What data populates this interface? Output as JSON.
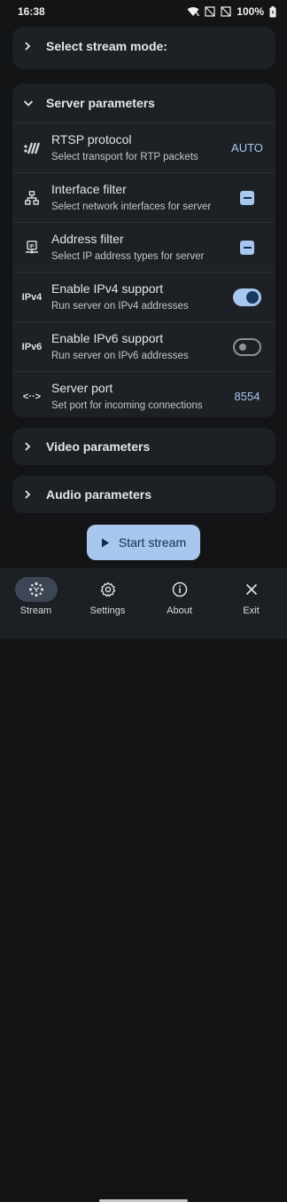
{
  "status_bar": {
    "time": "16:38",
    "battery": "100%"
  },
  "stream_mode": {
    "label": "Select stream mode:"
  },
  "server": {
    "label": "Server parameters",
    "rtsp": {
      "icon_text": ":///",
      "title": "RTSP protocol",
      "subtitle": "Select transport for RTP packets",
      "value": "AUTO"
    },
    "interface_filter": {
      "title": "Interface filter",
      "subtitle": "Select network interfaces for server"
    },
    "address_filter": {
      "title": "Address filter",
      "subtitle": "Select IP address types for server"
    },
    "ipv4": {
      "icon_text": "IPv4",
      "title": "Enable IPv4 support",
      "subtitle": "Run server on IPv4 addresses",
      "enabled": true
    },
    "ipv6": {
      "icon_text": "IPv6",
      "title": "Enable IPv6 support",
      "subtitle": "Run server on IPv6 addresses",
      "enabled": false
    },
    "port": {
      "icon_text": "<··>",
      "title": "Server port",
      "subtitle": "Set port for incoming connections",
      "value": "8554"
    }
  },
  "video": {
    "label": "Video parameters"
  },
  "audio": {
    "label": "Audio parameters"
  },
  "start_button": {
    "label": "Start stream"
  },
  "nav": {
    "stream": "Stream",
    "settings": "Settings",
    "about": "About",
    "exit": "Exit"
  },
  "colors": {
    "accent": "#a9c7ee",
    "background": "#121416",
    "card": "#1d2024"
  }
}
